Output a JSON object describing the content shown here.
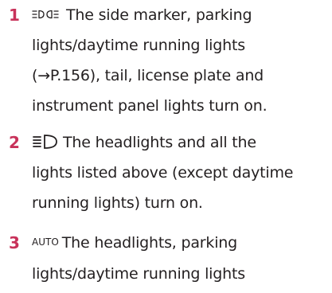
{
  "items": [
    {
      "number": "1",
      "icon": "side-marker-light-icon",
      "lines": [
        "The side marker, parking",
        "lights/daytime running lights",
        "(→P.156), tail, license plate and",
        "instrument panel lights turn on."
      ]
    },
    {
      "number": "2",
      "icon": "headlight-icon",
      "lines": [
        "The headlights and all the",
        "lights listed above (except daytime",
        "running lights) turn on."
      ]
    },
    {
      "number": "3",
      "icon": "auto-light-icon",
      "auto_label": "AUTO",
      "lines": [
        "The headlights, parking",
        "lights/daytime running lights"
      ]
    }
  ],
  "colors": {
    "number": "#c8325a",
    "text": "#231f20"
  }
}
